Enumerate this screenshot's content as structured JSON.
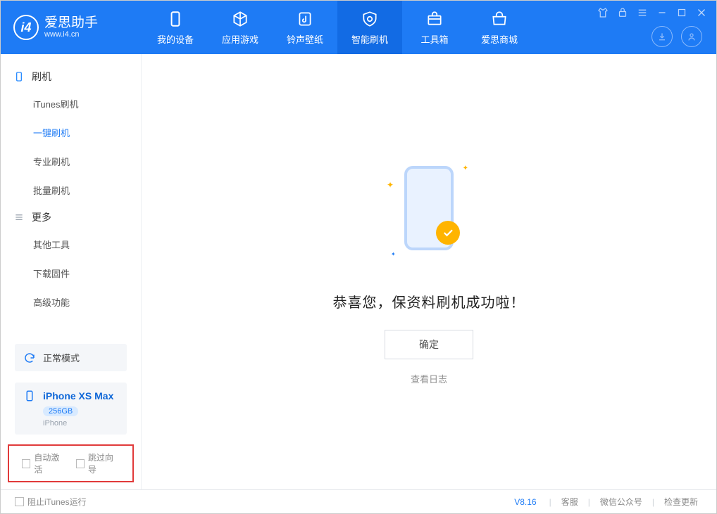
{
  "app": {
    "name_cn": "爱思助手",
    "name_en": "www.i4.cn"
  },
  "nav": {
    "mydevice": "我的设备",
    "apps": "应用游戏",
    "ring": "铃声壁纸",
    "flash": "智能刷机",
    "toolbox": "工具箱",
    "store": "爱思商城"
  },
  "sidebar": {
    "group_flash": "刷机",
    "items_flash": [
      "iTunes刷机",
      "一键刷机",
      "专业刷机",
      "批量刷机"
    ],
    "group_more": "更多",
    "items_more": [
      "其他工具",
      "下载固件",
      "高级功能"
    ],
    "mode_card": "正常模式",
    "device_name": "iPhone XS Max",
    "device_capacity": "256GB",
    "device_type": "iPhone",
    "chk_auto_activate": "自动激活",
    "chk_skip_guide": "跳过向导"
  },
  "main": {
    "success": "恭喜您，保资料刷机成功啦！",
    "ok": "确定",
    "view_log": "查看日志"
  },
  "status": {
    "block_itunes": "阻止iTunes运行",
    "version": "V8.16",
    "cs": "客服",
    "wechat": "微信公众号",
    "update": "检查更新"
  }
}
